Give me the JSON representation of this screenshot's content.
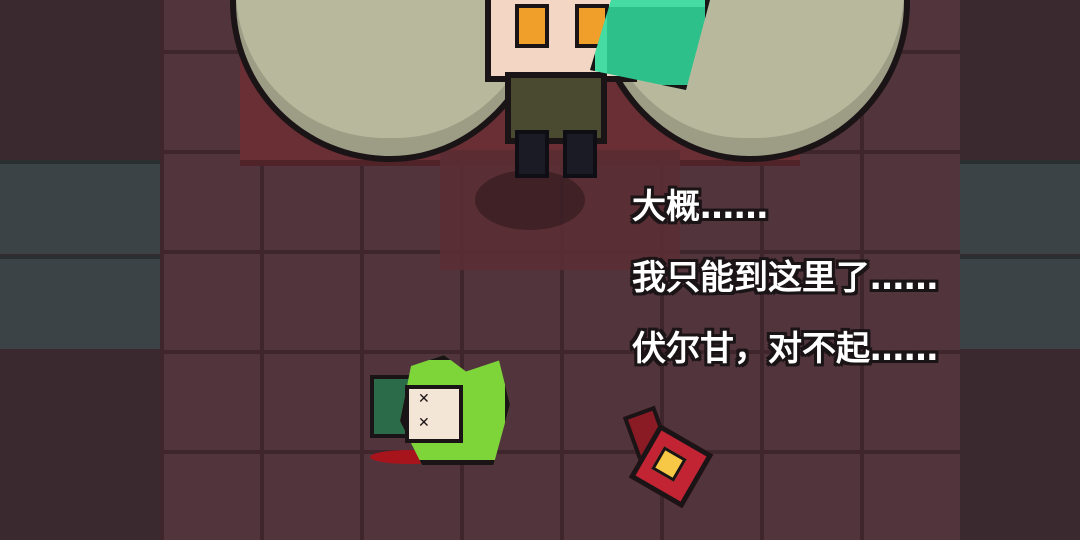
{
  "dialogue": {
    "lines": [
      "大概……",
      "我只能到这里了……",
      "伏尔甘，对不起……"
    ]
  },
  "scene": {
    "boss": "horned-boss-character",
    "fallen_hero": "green-haired-hero-knocked-out",
    "dropped_item": "red-weapon"
  },
  "colors": {
    "floor": "#52343c",
    "carpet": "#6a2f35",
    "wall": "#3c4347",
    "boss_horn": "#b8b89c",
    "boss_eye": "#f0a02a",
    "crystal": "#2ec08a",
    "hero_hair": "#7ed53a",
    "blood": "#a8141c",
    "weapon": "#c22434",
    "text": "#ffffff",
    "text_outline": "#1b1416"
  }
}
